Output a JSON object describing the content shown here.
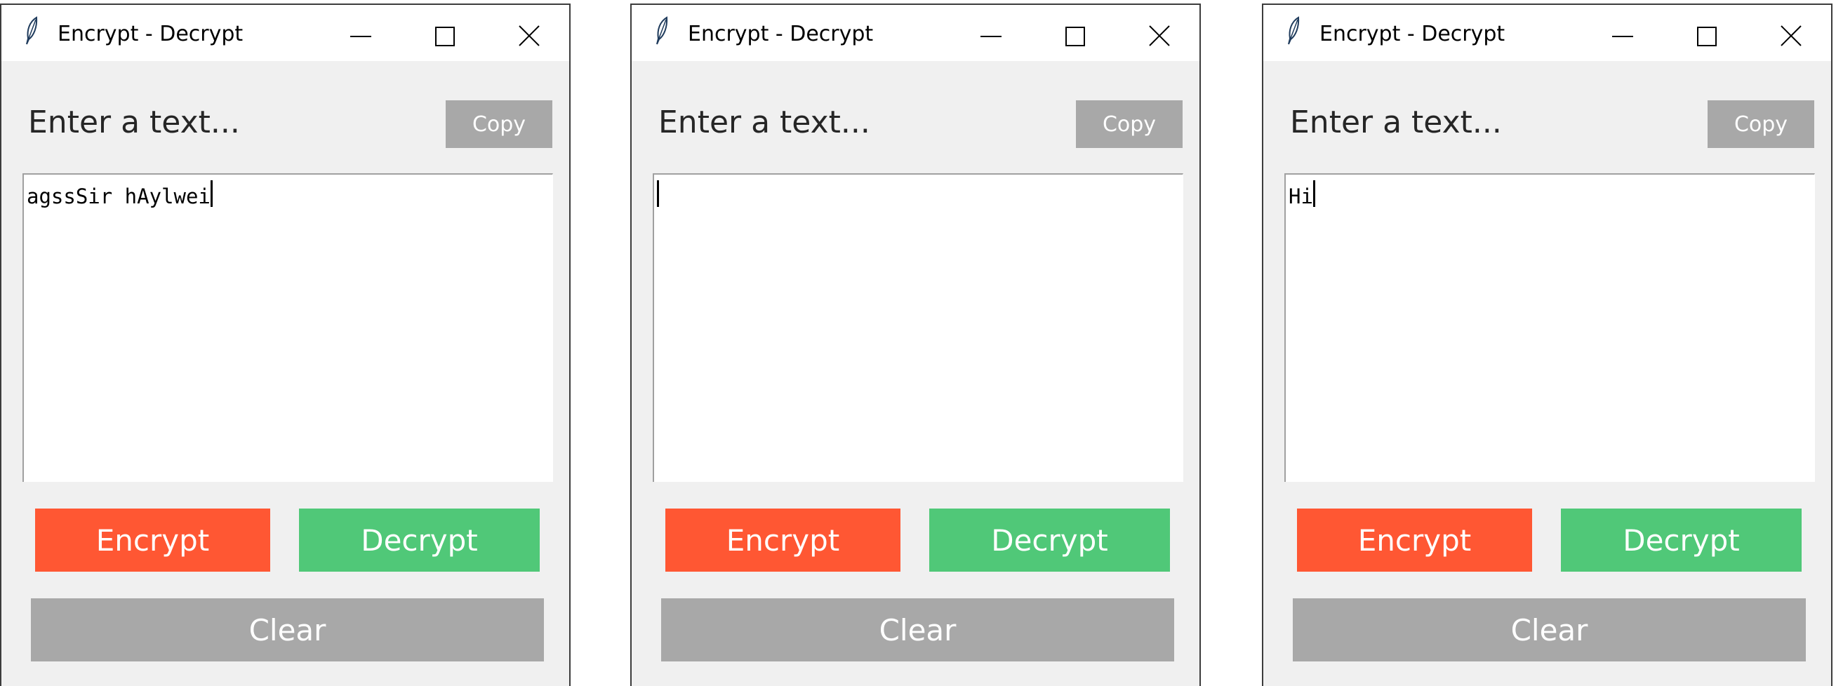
{
  "windows": [
    {
      "title": "Encrypt - Decrypt",
      "prompt": "Enter a text...",
      "copy_label": "Copy",
      "text_value": "agssSir hAylwei",
      "encrypt_label": "Encrypt",
      "decrypt_label": "Decrypt",
      "clear_label": "Clear"
    },
    {
      "title": "Encrypt - Decrypt",
      "prompt": "Enter a text...",
      "copy_label": "Copy",
      "text_value": "",
      "encrypt_label": "Encrypt",
      "decrypt_label": "Decrypt",
      "clear_label": "Clear"
    },
    {
      "title": "Encrypt - Decrypt",
      "prompt": "Enter a text...",
      "copy_label": "Copy",
      "text_value": "Hi",
      "encrypt_label": "Encrypt",
      "decrypt_label": "Decrypt",
      "clear_label": "Clear"
    }
  ],
  "icons": {
    "app": "feather-icon",
    "minimize": "minimize-icon",
    "maximize": "maximize-icon",
    "close": "close-icon"
  },
  "colors": {
    "encrypt": "#ff5733",
    "decrypt": "#50c878",
    "neutral_button": "#a8a8a8",
    "window_background": "#f0f0f0"
  }
}
